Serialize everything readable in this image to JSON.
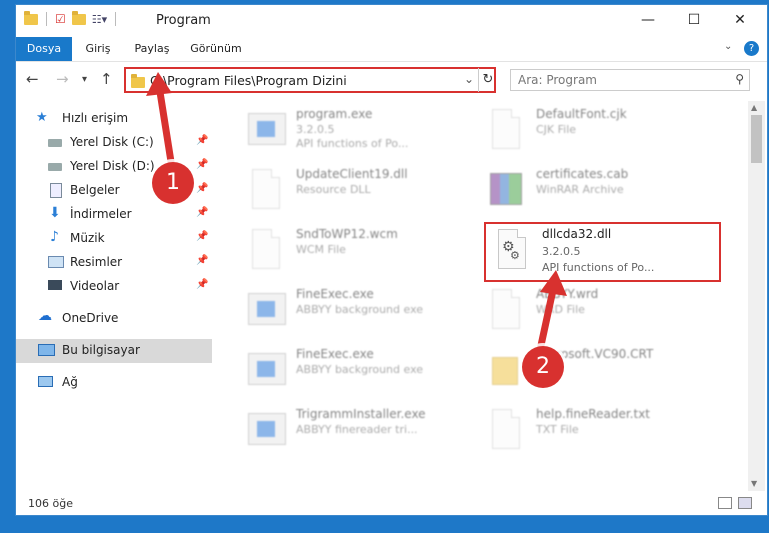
{
  "window": {
    "title": "Program",
    "minimize": "—",
    "maximize": "☐",
    "close": "✕"
  },
  "ribbon": {
    "tabs": [
      "Dosya",
      "Giriş",
      "Paylaş",
      "Görünüm"
    ],
    "help": "?"
  },
  "nav": {
    "address": "C:\\Program Files\\Program Dizini",
    "search_placeholder": "Ara: Program"
  },
  "sidebar": {
    "quick_access": "Hızlı erişim",
    "items": [
      {
        "label": "Yerel Disk (C:)",
        "icon": "drive-icon"
      },
      {
        "label": "Yerel Disk (D:)",
        "icon": "drive-icon"
      },
      {
        "label": "Belgeler",
        "icon": "documents-icon"
      },
      {
        "label": "İndirmeler",
        "icon": "download-icon"
      },
      {
        "label": "Müzik",
        "icon": "music-icon"
      },
      {
        "label": "Resimler",
        "icon": "pictures-icon"
      },
      {
        "label": "Videolar",
        "icon": "videos-icon"
      }
    ],
    "onedrive": "OneDrive",
    "this_pc": "Bu bilgisayar",
    "network": "Ağ"
  },
  "files": [
    {
      "name": "program.exe",
      "sub1": "3.2.0.5",
      "sub2": "API functions of Po...",
      "type": "exe"
    },
    {
      "name": "DefaultFont.cjk",
      "sub1": "CJK File",
      "sub2": "",
      "type": "doc"
    },
    {
      "name": "UpdateClient19.dll",
      "sub1": "Resource DLL",
      "sub2": "",
      "type": "dll"
    },
    {
      "name": "certificates.cab",
      "sub1": "WinRAR Archive",
      "sub2": "",
      "type": "cab"
    },
    {
      "name": "SndToWP12.wcm",
      "sub1": "WCM File",
      "sub2": "",
      "type": "doc"
    },
    {
      "name": "dllcda32.dll",
      "sub1": "3.2.0.5",
      "sub2": "API functions of Po...",
      "type": "dll"
    },
    {
      "name": "FineExec.exe",
      "sub1": "ABBYY background exe",
      "sub2": "",
      "type": "exe"
    },
    {
      "name": "ABBYY.wrd",
      "sub1": "WRD File",
      "sub2": "",
      "type": "doc"
    },
    {
      "name": "FineExec.exe",
      "sub1": "ABBYY background exe",
      "sub2": "",
      "type": "exe"
    },
    {
      "name": "Microsoft.VC90.CRT",
      "sub1": "",
      "sub2": "",
      "type": "folder"
    },
    {
      "name": "TrigrammInstaller.exe",
      "sub1": "ABBYY finereader tri...",
      "sub2": "",
      "type": "exe"
    },
    {
      "name": "help.fineReader.txt",
      "sub1": "TXT File",
      "sub2": "",
      "type": "doc"
    }
  ],
  "status": {
    "count": "106 öğe"
  },
  "annotations": {
    "step1": "1",
    "step2": "2"
  },
  "colors": {
    "accent": "#1979ca",
    "highlight": "#d8312f"
  }
}
